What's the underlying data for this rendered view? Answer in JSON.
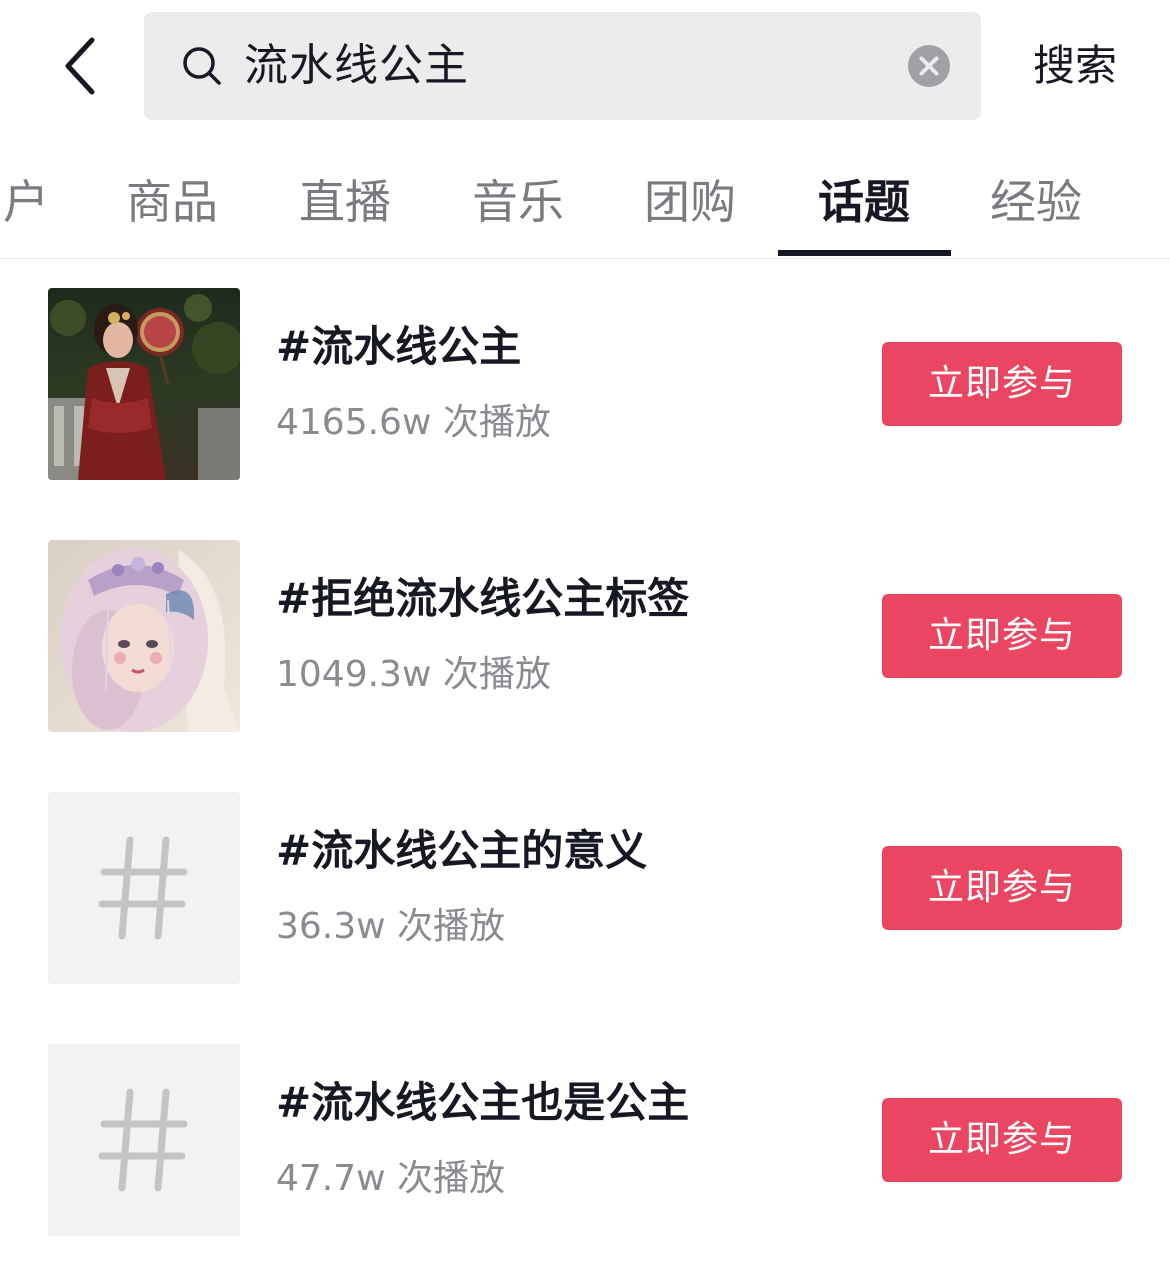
{
  "header": {
    "search_query": "流水线公主",
    "search_button": "搜索"
  },
  "tabs": [
    {
      "label": "户"
    },
    {
      "label": "商品"
    },
    {
      "label": "直播"
    },
    {
      "label": "音乐"
    },
    {
      "label": "团购"
    },
    {
      "label": "话题",
      "active": true
    },
    {
      "label": "经验"
    }
  ],
  "topics": [
    {
      "title": "#流水线公主",
      "plays": "4165.6w 次播放",
      "button": "立即参与",
      "thumb": "photo-red-hanfu"
    },
    {
      "title": "#拒绝流水线公主标签",
      "plays": "1049.3w 次播放",
      "button": "立即参与",
      "thumb": "photo-pink-lolita"
    },
    {
      "title": "#流水线公主的意义",
      "plays": "36.3w 次播放",
      "button": "立即参与",
      "thumb": "hashtag-icon"
    },
    {
      "title": "#流水线公主也是公主",
      "plays": "47.7w 次播放",
      "button": "立即参与",
      "thumb": "hashtag-icon"
    }
  ],
  "colors": {
    "accent": "#ea4561",
    "text_primary": "#161823",
    "text_secondary": "#8a8b91",
    "search_bg": "#ececec"
  }
}
